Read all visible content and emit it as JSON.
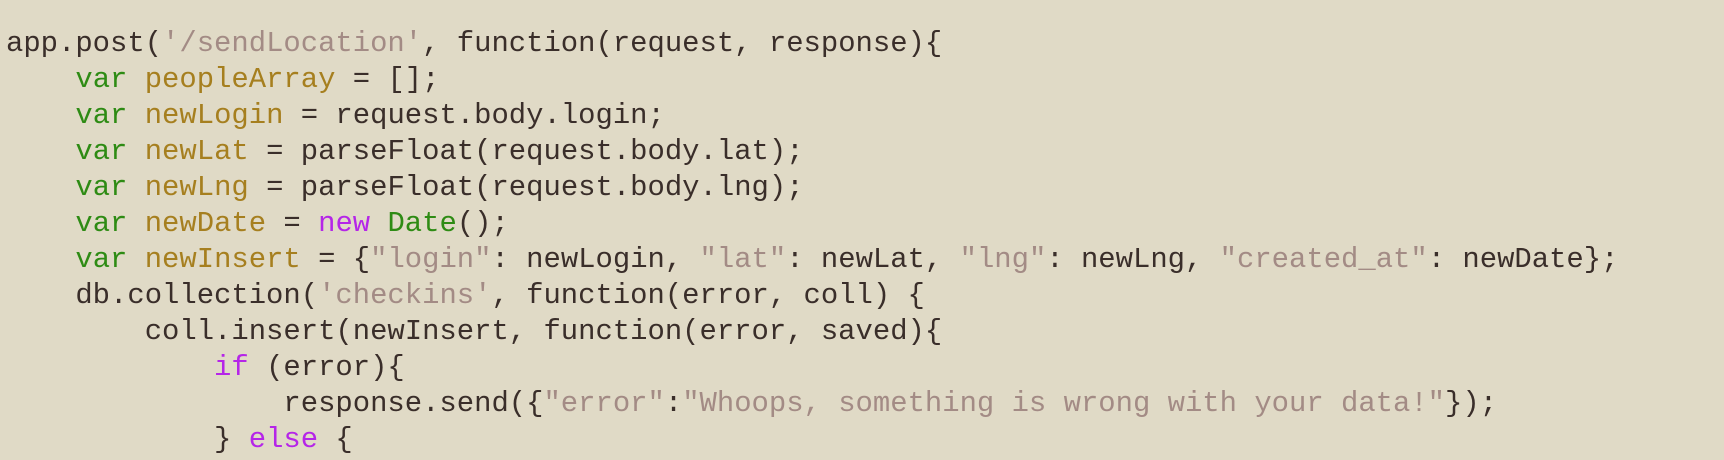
{
  "code": {
    "lines": [
      [
        {
          "t": "app.post(",
          "c": "plain"
        },
        {
          "t": "'/sendLocation'",
          "c": "str"
        },
        {
          "t": ", function(request, response){",
          "c": "plain"
        }
      ],
      [
        {
          "t": "    ",
          "c": "plain"
        },
        {
          "t": "var",
          "c": "kw-var"
        },
        {
          "t": " ",
          "c": "plain"
        },
        {
          "t": "peopleArray",
          "c": "ident"
        },
        {
          "t": " = [];",
          "c": "plain"
        }
      ],
      [
        {
          "t": "    ",
          "c": "plain"
        },
        {
          "t": "var",
          "c": "kw-var"
        },
        {
          "t": " ",
          "c": "plain"
        },
        {
          "t": "newLogin",
          "c": "ident"
        },
        {
          "t": " = request.body.login;",
          "c": "plain"
        }
      ],
      [
        {
          "t": "    ",
          "c": "plain"
        },
        {
          "t": "var",
          "c": "kw-var"
        },
        {
          "t": " ",
          "c": "plain"
        },
        {
          "t": "newLat",
          "c": "ident"
        },
        {
          "t": " = parseFloat(request.body.lat);",
          "c": "plain"
        }
      ],
      [
        {
          "t": "    ",
          "c": "plain"
        },
        {
          "t": "var",
          "c": "kw-var"
        },
        {
          "t": " ",
          "c": "plain"
        },
        {
          "t": "newLng",
          "c": "ident"
        },
        {
          "t": " = parseFloat(request.body.lng);",
          "c": "plain"
        }
      ],
      [
        {
          "t": "    ",
          "c": "plain"
        },
        {
          "t": "var",
          "c": "kw-var"
        },
        {
          "t": " ",
          "c": "plain"
        },
        {
          "t": "newDate",
          "c": "ident"
        },
        {
          "t": " = ",
          "c": "plain"
        },
        {
          "t": "new",
          "c": "kw-ctl"
        },
        {
          "t": " ",
          "c": "plain"
        },
        {
          "t": "Date",
          "c": "cls"
        },
        {
          "t": "();",
          "c": "plain"
        }
      ],
      [
        {
          "t": "    ",
          "c": "plain"
        },
        {
          "t": "var",
          "c": "kw-var"
        },
        {
          "t": " ",
          "c": "plain"
        },
        {
          "t": "newInsert",
          "c": "ident"
        },
        {
          "t": " = {",
          "c": "plain"
        },
        {
          "t": "\"login\"",
          "c": "str"
        },
        {
          "t": ": newLogin, ",
          "c": "plain"
        },
        {
          "t": "\"lat\"",
          "c": "str"
        },
        {
          "t": ": newLat, ",
          "c": "plain"
        },
        {
          "t": "\"lng\"",
          "c": "str"
        },
        {
          "t": ": newLng, ",
          "c": "plain"
        },
        {
          "t": "\"created_at\"",
          "c": "str"
        },
        {
          "t": ": newDate};",
          "c": "plain"
        }
      ],
      [
        {
          "t": "    db.collection(",
          "c": "plain"
        },
        {
          "t": "'checkins'",
          "c": "str"
        },
        {
          "t": ", function(error, coll) {",
          "c": "plain"
        }
      ],
      [
        {
          "t": "        coll.insert(newInsert, function(error, saved){",
          "c": "plain"
        }
      ],
      [
        {
          "t": "            ",
          "c": "plain"
        },
        {
          "t": "if",
          "c": "kw-ctl"
        },
        {
          "t": " (error){",
          "c": "plain"
        }
      ],
      [
        {
          "t": "                response.send({",
          "c": "plain"
        },
        {
          "t": "\"error\"",
          "c": "str"
        },
        {
          "t": ":",
          "c": "plain"
        },
        {
          "t": "\"Whoops, something is wrong with your data!\"",
          "c": "str"
        },
        {
          "t": "});",
          "c": "plain"
        }
      ],
      [
        {
          "t": "            } ",
          "c": "plain"
        },
        {
          "t": "else",
          "c": "kw-ctl"
        },
        {
          "t": " {",
          "c": "plain"
        }
      ]
    ],
    "colors": {
      "background": "#e0dac6",
      "plain": "#3a2e2a",
      "keyword_var": "#2e8b14",
      "keyword_control": "#b525e8",
      "identifier": "#a67f1f",
      "string": "#a38b85"
    }
  }
}
